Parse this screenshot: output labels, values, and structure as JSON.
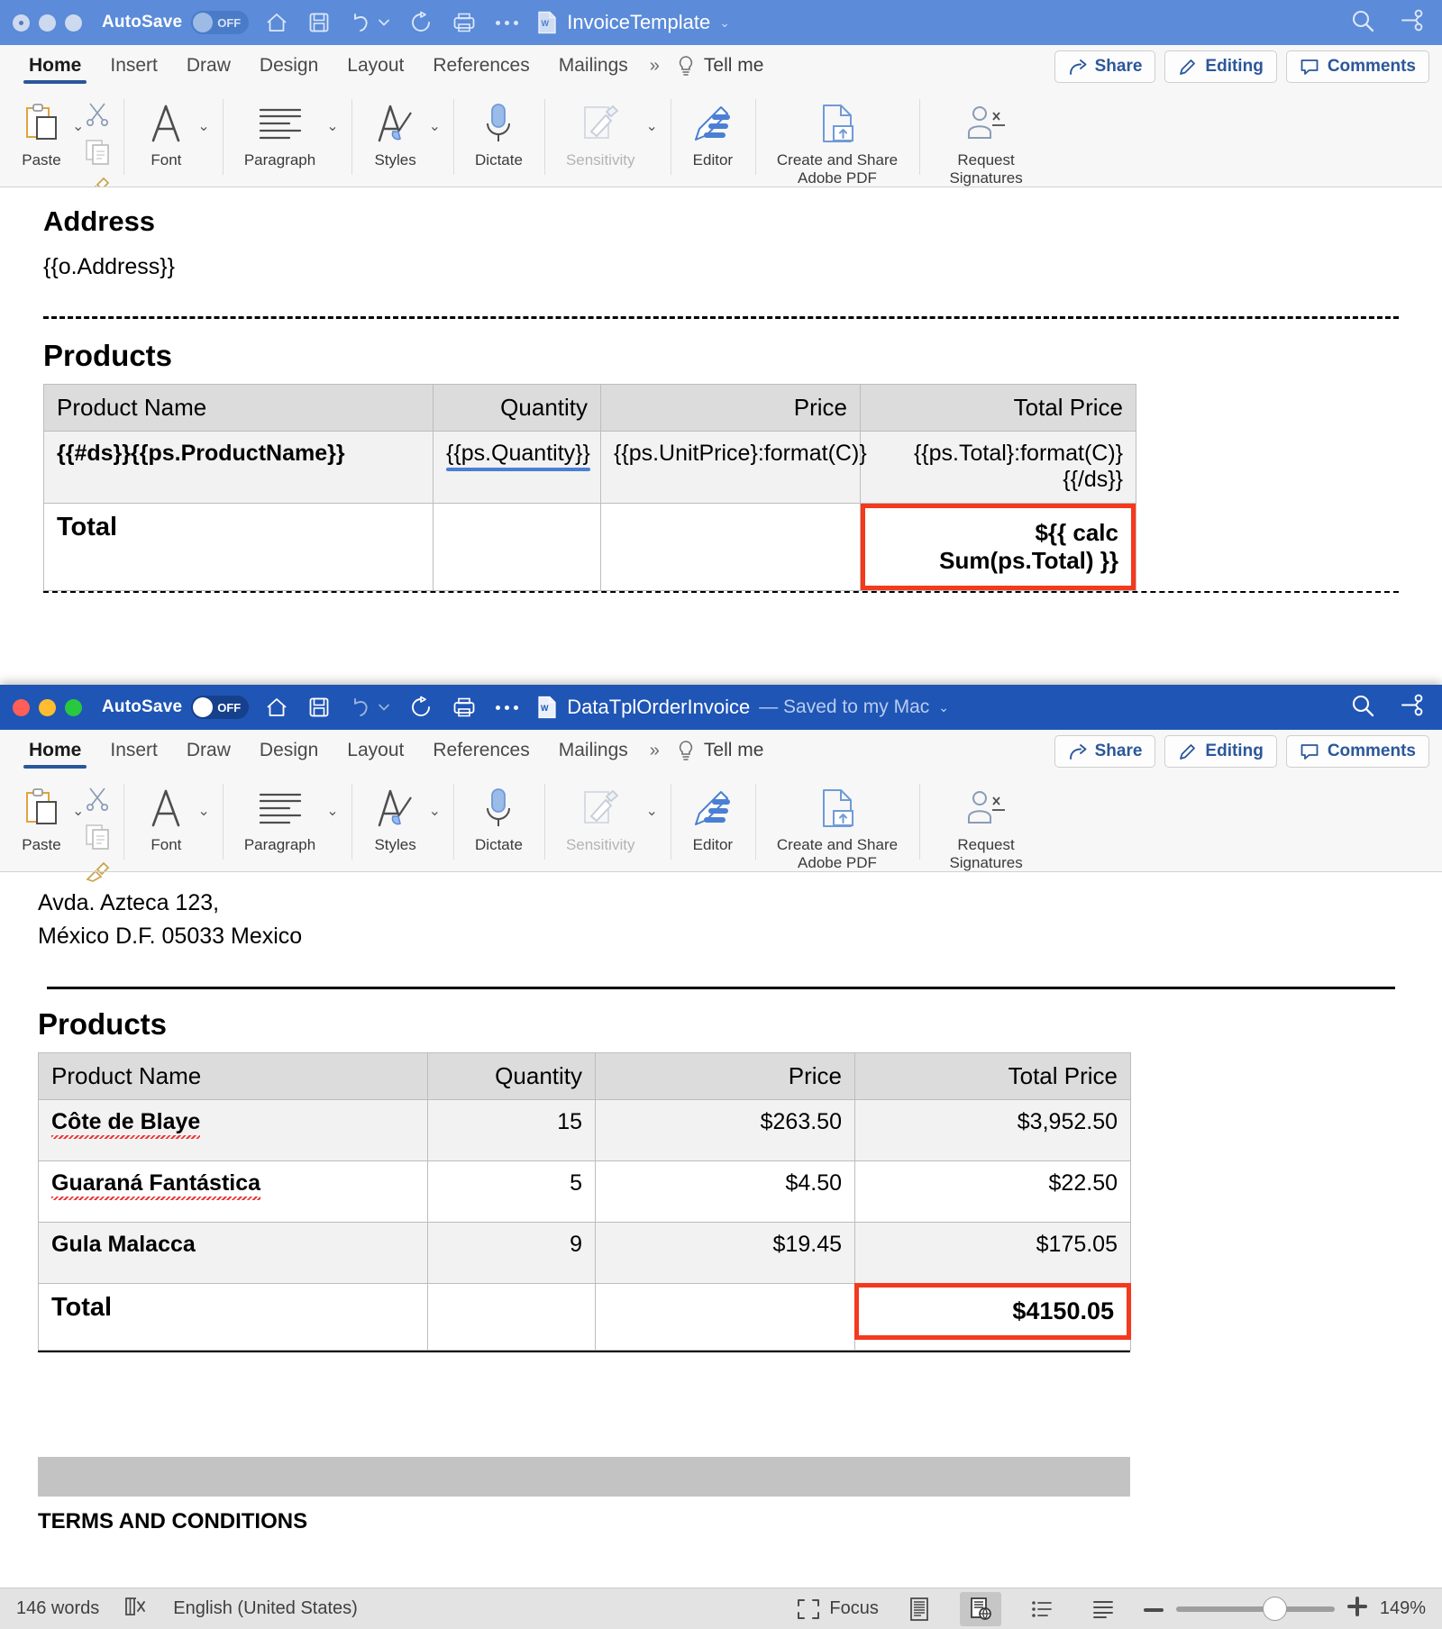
{
  "window_template": {
    "titlebar": {
      "autosave_label": "AutoSave",
      "autosave_state": "OFF",
      "doc_title": "InvoiceTemplate",
      "icons": [
        "home-icon",
        "save-icon",
        "undo-icon",
        "redo-icon",
        "print-icon",
        "more-icon"
      ],
      "search_icon": "search-icon",
      "ribbon_display_icon": "ribbon-display-options-icon"
    },
    "tabs": [
      {
        "label": "Home",
        "active": true
      },
      {
        "label": "Insert",
        "active": false
      },
      {
        "label": "Draw",
        "active": false
      },
      {
        "label": "Design",
        "active": false
      },
      {
        "label": "Layout",
        "active": false
      },
      {
        "label": "References",
        "active": false
      },
      {
        "label": "Mailings",
        "active": false
      }
    ],
    "tell_me": "Tell me",
    "actions": [
      {
        "label": "Share",
        "icon": "share-icon"
      },
      {
        "label": "Editing",
        "icon": "pencil-icon"
      },
      {
        "label": "Comments",
        "icon": "comment-icon"
      }
    ],
    "ribbon": [
      {
        "label": "Paste",
        "icon": "paste-icon",
        "chevron": true,
        "dim": false
      },
      {
        "label": "Font",
        "icon": "font-icon",
        "chevron": true,
        "dim": false
      },
      {
        "label": "Paragraph",
        "icon": "paragraph-icon",
        "chevron": true,
        "dim": false
      },
      {
        "label": "Styles",
        "icon": "styles-icon",
        "chevron": true,
        "dim": false
      },
      {
        "label": "Dictate",
        "icon": "microphone-icon",
        "chevron": false,
        "dim": false
      },
      {
        "label": "Sensitivity",
        "icon": "sensitivity-icon",
        "chevron": true,
        "dim": true
      },
      {
        "label": "Editor",
        "icon": "editor-icon",
        "chevron": false,
        "dim": false
      },
      {
        "label": "Create and Share\nAdobe PDF",
        "icon": "adobe-pdf-icon",
        "chevron": false,
        "dim": false
      },
      {
        "label": "Request\nSignatures",
        "icon": "request-signatures-icon",
        "chevron": false,
        "dim": false
      }
    ],
    "ribbon_mini": [
      "cut-icon",
      "copy-icon",
      "format-painter-icon"
    ],
    "document": {
      "address_heading": "Address",
      "address_value": "{{o.Address}}",
      "products_heading": "Products",
      "table": {
        "columns": [
          "Product Name",
          "Quantity",
          "Price",
          "Total Price"
        ],
        "rows": [
          {
            "name": "{{#ds}}{{ps.ProductName}}",
            "qty": "{{ps.Quantity}}",
            "price": "{{ps.UnitPrice}:format(C)}",
            "total": "{{ps.Total}:format(C)}{{/ds}}"
          }
        ],
        "total_label": "Total",
        "total_value": "${{ calc Sum(ps.Total) }}",
        "total_highlight_color": "#f4391d"
      }
    }
  },
  "window_result": {
    "titlebar": {
      "autosave_label": "AutoSave",
      "autosave_state": "OFF",
      "doc_title": "DataTplOrderInvoice",
      "doc_status": "— Saved to my Mac",
      "icons": [
        "home-icon",
        "save-icon",
        "undo-icon",
        "redo-icon",
        "print-icon",
        "more-icon"
      ],
      "search_icon": "search-icon",
      "ribbon_display_icon": "ribbon-display-options-icon"
    },
    "tabs": [
      {
        "label": "Home",
        "active": true
      },
      {
        "label": "Insert",
        "active": false
      },
      {
        "label": "Draw",
        "active": false
      },
      {
        "label": "Design",
        "active": false
      },
      {
        "label": "Layout",
        "active": false
      },
      {
        "label": "References",
        "active": false
      },
      {
        "label": "Mailings",
        "active": false
      }
    ],
    "tell_me": "Tell me",
    "actions": [
      {
        "label": "Share",
        "icon": "share-icon"
      },
      {
        "label": "Editing",
        "icon": "pencil-icon"
      },
      {
        "label": "Comments",
        "icon": "comment-icon"
      }
    ],
    "ribbon": [
      {
        "label": "Paste",
        "icon": "paste-icon",
        "chevron": true,
        "dim": false
      },
      {
        "label": "Font",
        "icon": "font-icon",
        "chevron": true,
        "dim": false
      },
      {
        "label": "Paragraph",
        "icon": "paragraph-icon",
        "chevron": true,
        "dim": false
      },
      {
        "label": "Styles",
        "icon": "styles-icon",
        "chevron": true,
        "dim": false
      },
      {
        "label": "Dictate",
        "icon": "microphone-icon",
        "chevron": false,
        "dim": false
      },
      {
        "label": "Sensitivity",
        "icon": "sensitivity-icon",
        "chevron": true,
        "dim": true
      },
      {
        "label": "Editor",
        "icon": "editor-icon",
        "chevron": false,
        "dim": false
      },
      {
        "label": "Create and Share\nAdobe PDF",
        "icon": "adobe-pdf-icon",
        "chevron": false,
        "dim": false
      },
      {
        "label": "Request\nSignatures",
        "icon": "request-signatures-icon",
        "chevron": false,
        "dim": false
      }
    ],
    "document": {
      "address_line1": "Avda. Azteca 123,",
      "address_line2": "México D.F.  05033 Mexico",
      "products_heading": "Products",
      "table": {
        "columns": [
          "Product Name",
          "Quantity",
          "Price",
          "Total Price"
        ],
        "rows": [
          {
            "name": "Côte de Blaye",
            "qty": "15",
            "price": "$263.50",
            "total": "$3,952.50"
          },
          {
            "name": "Guaraná Fantástica",
            "qty": "5",
            "price": "$4.50",
            "total": "$22.50"
          },
          {
            "name": "Gula Malacca",
            "qty": "9",
            "price": "$19.45",
            "total": "$175.05"
          }
        ],
        "total_label": "Total",
        "total_value": "$4150.05",
        "total_highlight_color": "#f4391d"
      },
      "terms_heading": "TERMS AND CONDITIONS"
    },
    "statusbar": {
      "word_count": "146 words",
      "proofing_icon": "proofing-errors-icon",
      "language": "English (United States)",
      "focus_label": "Focus",
      "focus_icon": "focus-icon",
      "view_print_icon": "print-layout-view-icon",
      "view_web_icon": "web-layout-view-icon",
      "view_outline_icon": "outline-view-icon",
      "view_draft_icon": "draft-view-icon",
      "zoom_out_icon": "zoom-out-icon",
      "zoom_in_icon": "zoom-in-icon",
      "zoom_level": "149%"
    }
  }
}
